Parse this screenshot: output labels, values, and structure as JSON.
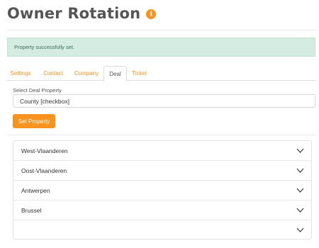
{
  "page": {
    "title": "Owner Rotation",
    "info_icon": "info-icon",
    "accent_color": "#f7931e"
  },
  "alert": {
    "message": "Property successfully set.",
    "type": "success"
  },
  "tabs": [
    {
      "label": "Settings",
      "active": false
    },
    {
      "label": "Contact",
      "active": false
    },
    {
      "label": "Company",
      "active": false
    },
    {
      "label": "Deal",
      "active": true
    },
    {
      "label": "Ticket",
      "active": false
    }
  ],
  "deal_property": {
    "label": "Select Deal Property",
    "selected": "County [checkbox]",
    "button_label": "Set Property"
  },
  "accordion": {
    "items": [
      {
        "label": "West-Vlaanderen",
        "icon": "chevron-down-icon"
      },
      {
        "label": "Oost-Vlaanderen",
        "icon": "chevron-down-icon"
      },
      {
        "label": "Antwerpen",
        "icon": "chevron-down-icon"
      },
      {
        "label": "Brussel",
        "icon": "chevron-down-icon"
      },
      {
        "label": "",
        "icon": "chevron-down-icon"
      }
    ]
  }
}
